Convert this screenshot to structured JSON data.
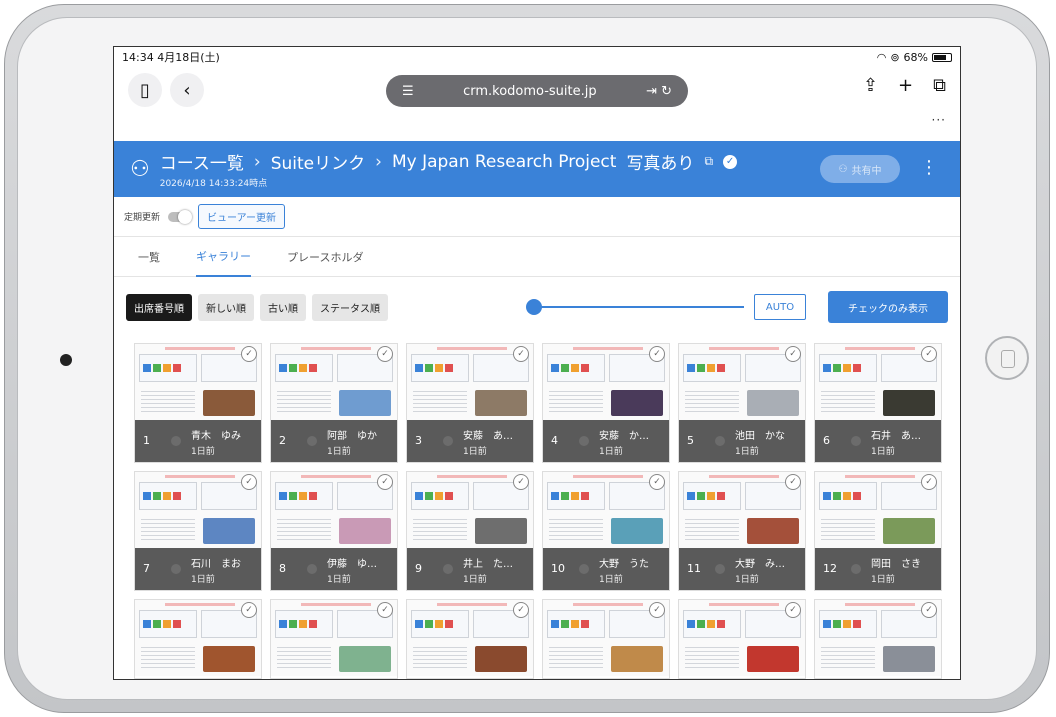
{
  "statusbar": {
    "time": "14:34",
    "date": "4月18日(土)",
    "battery": "68%"
  },
  "browser": {
    "url": "crm.kodomo-suite.jp",
    "more": "···"
  },
  "header": {
    "crumb1": "コース一覧",
    "crumb2": "Suiteリンク",
    "crumb3": "My Japan Research Project",
    "photo_badge": "写真あり",
    "sep": "›",
    "timestamp": "2026/4/18 14:33:24時点",
    "share_label": "共有中"
  },
  "refresh": {
    "label": "定期更新",
    "viewer_button": "ビューアー更新"
  },
  "tabs": [
    {
      "label": "一覧"
    },
    {
      "label": "ギャラリー"
    },
    {
      "label": "プレースホルダ"
    }
  ],
  "toolbar": {
    "sort_attendance": "出席番号順",
    "sort_new": "新しい順",
    "sort_old": "古い順",
    "sort_status": "ステータス順",
    "auto": "AUTO",
    "check_only": "チェックのみ表示"
  },
  "cards": [
    {
      "num": "1",
      "name": "青木　ゆみ",
      "time": "1日前",
      "photo": "#8a5a3a"
    },
    {
      "num": "2",
      "name": "阿部　ゆか",
      "time": "1日前",
      "photo": "#6f9cd0"
    },
    {
      "num": "3",
      "name": "安藤　あ…",
      "time": "1日前",
      "photo": "#8d7a66"
    },
    {
      "num": "4",
      "name": "安藤　か…",
      "time": "1日前",
      "photo": "#4a3a5a"
    },
    {
      "num": "5",
      "name": "池田　かな",
      "time": "1日前",
      "photo": "#a9aeb5"
    },
    {
      "num": "6",
      "name": "石井　あ…",
      "time": "1日前",
      "photo": "#3a3a32"
    },
    {
      "num": "7",
      "name": "石川　まお",
      "time": "1日前",
      "photo": "#5d86c2"
    },
    {
      "num": "8",
      "name": "伊藤　ゆ…",
      "time": "1日前",
      "photo": "#c99ab6"
    },
    {
      "num": "9",
      "name": "井上　た…",
      "time": "1日前",
      "photo": "#6e6e6e"
    },
    {
      "num": "10",
      "name": "大野　うた",
      "time": "1日前",
      "photo": "#5aa0b8"
    },
    {
      "num": "11",
      "name": "大野　み…",
      "time": "1日前",
      "photo": "#a4503a"
    },
    {
      "num": "12",
      "name": "岡田　さき",
      "time": "1日前",
      "photo": "#7b9a5a"
    }
  ],
  "cards_row3_photos": [
    "#a0552e",
    "#7fb28f",
    "#8a4a2e",
    "#c08a4a",
    "#c2372e",
    "#8a8f98"
  ]
}
